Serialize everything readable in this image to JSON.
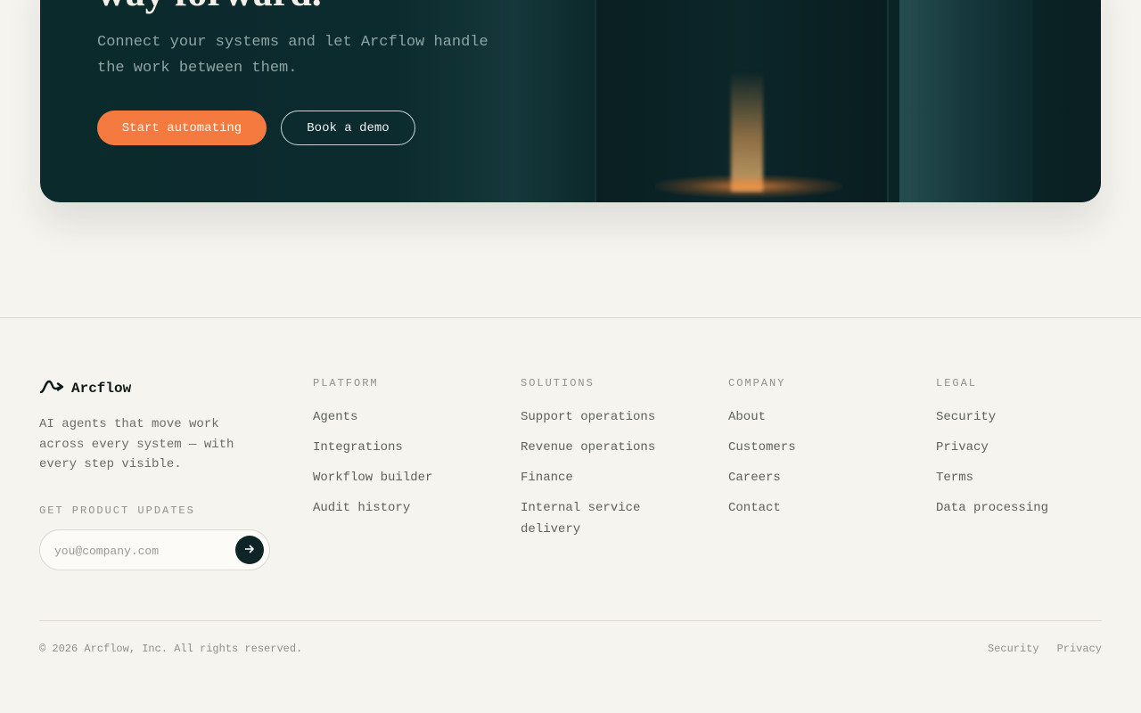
{
  "hero": {
    "heading": "way forward.",
    "subtitle": "Connect your systems and let Arcflow handle the work between them.",
    "primary_cta": "Start automating",
    "secondary_cta": "Book a demo"
  },
  "footer": {
    "brand": {
      "name": "Arcflow",
      "description": "AI agents that move work across every system — with every step visible."
    },
    "newsletter": {
      "label": "GET PRODUCT UPDATES",
      "placeholder": "you@company.com",
      "value": ""
    },
    "columns": [
      {
        "heading": "PLATFORM",
        "links": [
          "Agents",
          "Integrations",
          "Workflow builder",
          "Audit history"
        ]
      },
      {
        "heading": "SOLUTIONS",
        "links": [
          "Support operations",
          "Revenue operations",
          "Finance",
          "Internal service delivery"
        ]
      },
      {
        "heading": "COMPANY",
        "links": [
          "About",
          "Customers",
          "Careers",
          "Contact"
        ]
      },
      {
        "heading": "LEGAL",
        "links": [
          "Security",
          "Privacy",
          "Terms",
          "Data processing"
        ]
      }
    ],
    "copyright": "© 2026 Arcflow, Inc. All rights reserved.",
    "bottom_links": [
      "Security",
      "Privacy"
    ]
  },
  "colors": {
    "accent": "#f47a3f",
    "hero_bg": "#0b2a2c",
    "page_bg": "#f6f4ef"
  },
  "icons": {
    "logo": "arcflow-logo-icon",
    "submit": "arrow-right-icon"
  }
}
